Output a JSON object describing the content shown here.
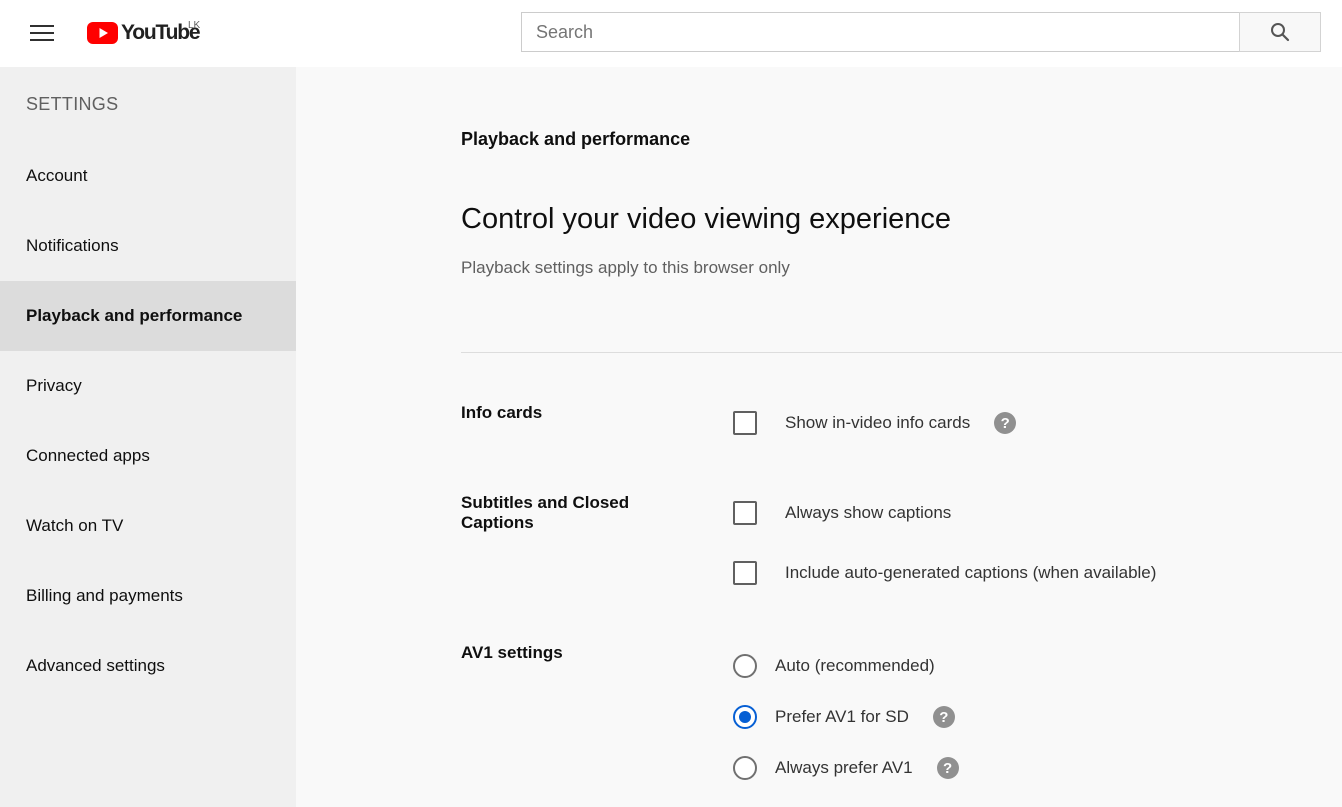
{
  "header": {
    "logo_text": "YouTube",
    "country_code": "LK",
    "search_placeholder": "Search",
    "brand_color": "#ff0000"
  },
  "sidebar": {
    "heading": "SETTINGS",
    "items": [
      {
        "label": "Account",
        "active": false
      },
      {
        "label": "Notifications",
        "active": false
      },
      {
        "label": "Playback and performance",
        "active": true
      },
      {
        "label": "Privacy",
        "active": false
      },
      {
        "label": "Connected apps",
        "active": false
      },
      {
        "label": "Watch on TV",
        "active": false
      },
      {
        "label": "Billing and payments",
        "active": false
      },
      {
        "label": "Advanced settings",
        "active": false
      }
    ]
  },
  "main": {
    "section_title": "Playback and performance",
    "title": "Control your video viewing experience",
    "subtitle": "Playback settings apply to this browser only",
    "info_cards": {
      "label": "Info cards",
      "options": [
        {
          "label": "Show in-video info cards",
          "checked": false,
          "has_help": true
        }
      ]
    },
    "captions": {
      "label": "Subtitles and Closed Captions",
      "options": [
        {
          "label": "Always show captions",
          "checked": false
        },
        {
          "label": "Include auto-generated captions (when available)",
          "checked": false
        }
      ]
    },
    "av1": {
      "label": "AV1 settings",
      "options": [
        {
          "label": "Auto (recommended)",
          "selected": false,
          "has_help": false
        },
        {
          "label": "Prefer AV1 for SD",
          "selected": true,
          "has_help": true
        },
        {
          "label": "Always prefer AV1",
          "selected": false,
          "has_help": true
        }
      ]
    }
  }
}
